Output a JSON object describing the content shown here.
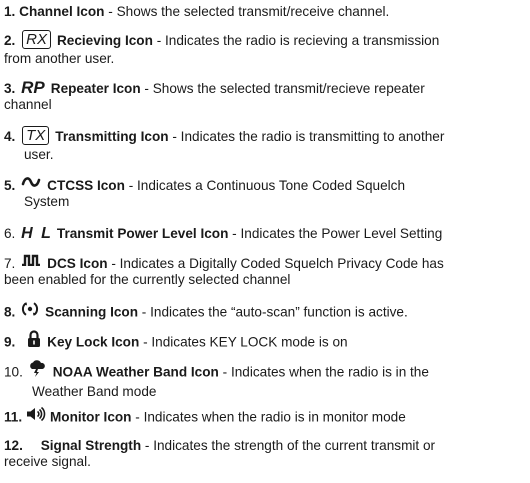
{
  "items": [
    {
      "num": "1.",
      "title": "Channel Icon",
      "desc": " - Shows the selected transmit/receive channel.",
      "cont": ""
    },
    {
      "num": "2.",
      "icon_text": "RX",
      "icon": "rx-icon",
      "title": "Recieving Icon",
      "desc": " - Indicates the radio is recieving a transmission",
      "cont": "from another user."
    },
    {
      "num": "3.",
      "icon_text": "RP",
      "icon": "rp-icon",
      "title": "Repeater Icon",
      "desc": " - Shows the selected transmit/recieve repeater",
      "cont": "channel"
    },
    {
      "num": "4.",
      "icon_text": "TX",
      "icon": "tx-icon",
      "title": "Transmitting Icon",
      "desc": " - Indicates the radio is transmitting to another",
      "cont": "user."
    },
    {
      "num": "5.",
      "icon": "ctcss-wave-icon",
      "title": "CTCSS Icon",
      "desc": " - Indicates a Continuous Tone Coded Squelch",
      "cont": "System"
    },
    {
      "num": "6.",
      "icon_text": "H L",
      "icon": "power-level-icon",
      "title": "Transmit Power Level Icon",
      "desc": " - Indicates the Power Level Setting",
      "cont": ""
    },
    {
      "num": "7.",
      "icon": "dcs-pulse-icon",
      "title": "DCS Icon",
      "desc": " - Indicates a Digitally Coded Squelch Privacy Code has",
      "cont": "been enabled for the currently selected channel"
    },
    {
      "num": "8.",
      "icon": "scanning-icon",
      "title": "Scanning Icon",
      "desc": " - Indicates the “auto-scan” function is active.",
      "cont": ""
    },
    {
      "num": "9.",
      "icon": "key-lock-icon",
      "title": "Key Lock Icon",
      "desc": " -  Indicates KEY LOCK mode is on",
      "cont": ""
    },
    {
      "num": "10.",
      "icon": "weather-storm-icon",
      "title": "NOAA Weather Band Icon",
      "desc": " - Indicates when the radio is in the",
      "cont": "Weather Band mode"
    },
    {
      "num": "11.",
      "icon": "speaker-icon",
      "title": "Monitor Icon",
      "desc": " - Indicates when the radio is in monitor mode",
      "cont": ""
    },
    {
      "num": "12.",
      "title": "Signal Strength",
      "desc": " - Indicates the strength of the current transmit or",
      "cont": "receive signal."
    }
  ],
  "colors": {
    "text": "#1a1a1a",
    "background": "#ffffff"
  }
}
